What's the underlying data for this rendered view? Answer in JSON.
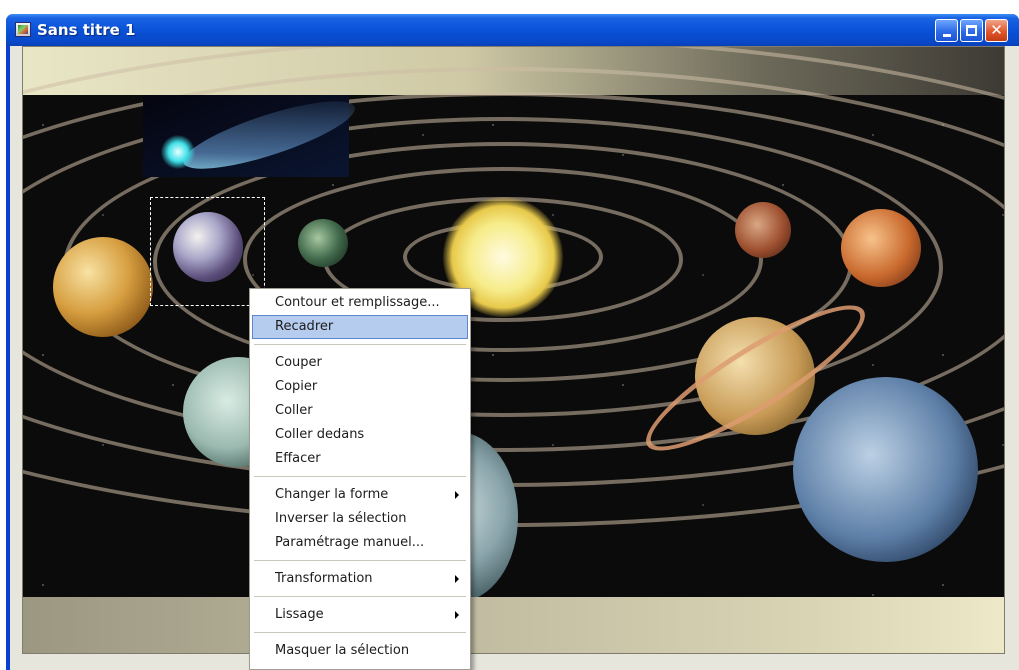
{
  "window": {
    "title": "Sans titre 1",
    "minimize_icon": "minimize-icon",
    "maximize_icon": "maximize-icon",
    "close_icon": "close-icon",
    "close_glyph": "✕"
  },
  "canvas": {
    "image_icon": "solar-system-image",
    "has_dashed_selection": true
  },
  "context_menu": {
    "items": [
      {
        "label": "Contour et remplissage...",
        "submenu": false
      },
      {
        "label": "Recadrer",
        "submenu": false,
        "highlighted": true
      },
      {
        "label": "Couper",
        "submenu": false
      },
      {
        "label": "Copier",
        "submenu": false
      },
      {
        "label": "Coller",
        "submenu": false
      },
      {
        "label": "Coller dedans",
        "submenu": false
      },
      {
        "label": "Effacer",
        "submenu": false
      },
      {
        "label": "Changer la forme",
        "submenu": true
      },
      {
        "label": "Inverser la sélection",
        "submenu": false
      },
      {
        "label": "Paramétrage manuel...",
        "submenu": false
      },
      {
        "label": "Transformation",
        "submenu": true
      },
      {
        "label": "Lissage",
        "submenu": true
      },
      {
        "label": "Masquer la sélection",
        "submenu": false
      }
    ]
  },
  "colors": {
    "titlebar": "#0a52d8",
    "menu_highlight": "#b6ccef",
    "close_button": "#e2572c"
  }
}
